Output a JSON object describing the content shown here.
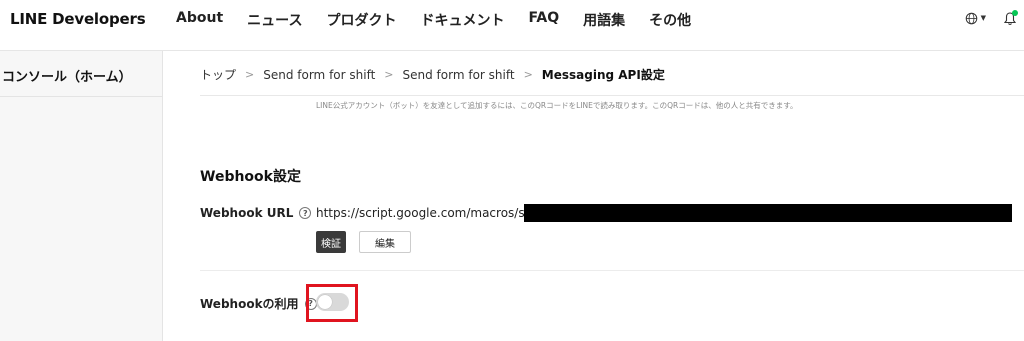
{
  "header": {
    "logo": "LINE Developers",
    "nav": [
      "About",
      "ニュース",
      "プロダクト",
      "ドキュメント",
      "FAQ",
      "用語集",
      "その他"
    ],
    "lang_icon": "globe-icon",
    "notification_icon": "bell-icon",
    "notification_dot_color": "#06c755"
  },
  "sidebar": {
    "items": [
      {
        "label": "コンソール（ホーム）"
      }
    ]
  },
  "breadcrumb": [
    "トップ",
    "Send form for shift",
    "Send form for shift",
    "Messaging API設定"
  ],
  "qr_note": "LINE公式アカウント（ボット）を友達として追加するには、このQRコードをLINEで読み取ります。このQRコードは、他の人と共有できます。",
  "webhook": {
    "section_title": "Webhook設定",
    "url_label": "Webhook URL",
    "url_value": "https://script.google.com/macros/s/AK",
    "verify_label": "検証",
    "edit_label": "編集",
    "use_label": "Webhookの利用",
    "use_enabled": false,
    "highlight_color": "#e0141f"
  }
}
